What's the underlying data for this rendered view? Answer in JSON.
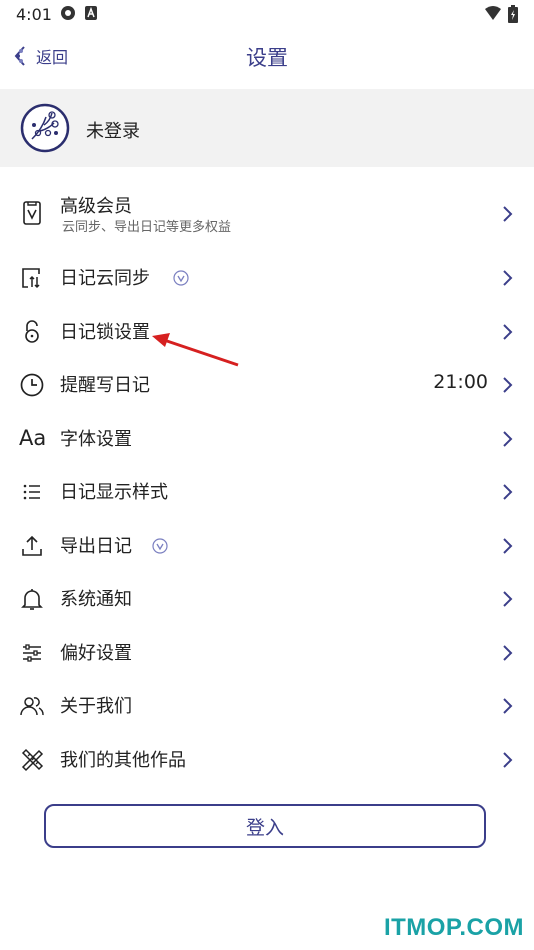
{
  "status": {
    "time": "4:01"
  },
  "header": {
    "back_label": "返回",
    "title": "设置"
  },
  "profile": {
    "label": "未登录"
  },
  "menu": {
    "items": [
      {
        "label": "高级会员",
        "subtitle": "云同步、导出日记等更多权益",
        "icon": "vip-card-icon"
      },
      {
        "label": "日记云同步",
        "icon": "cloud-sync-icon",
        "badge": "vip-badge-icon"
      },
      {
        "label": "日记锁设置",
        "icon": "lock-icon"
      },
      {
        "label": "提醒写日记",
        "icon": "clock-icon",
        "value": "21:00"
      },
      {
        "label": "字体设置",
        "icon": "font-icon",
        "glyph": "Aa"
      },
      {
        "label": "日记显示样式",
        "icon": "list-icon"
      },
      {
        "label": "导出日记",
        "icon": "export-icon",
        "badge": "vip-badge-icon"
      },
      {
        "label": "系统通知",
        "icon": "bell-icon"
      },
      {
        "label": "偏好设置",
        "icon": "sliders-icon"
      },
      {
        "label": "关于我们",
        "icon": "people-icon"
      },
      {
        "label": "我们的其他作品",
        "icon": "tools-icon"
      }
    ]
  },
  "login": {
    "label": "登入"
  },
  "watermark": "ITMOP.COM",
  "colors": {
    "accent": "#3b3e8a",
    "profile_bg": "#f2f2f2",
    "watermark": "#1aa2a6",
    "annotation": "#d62020"
  }
}
